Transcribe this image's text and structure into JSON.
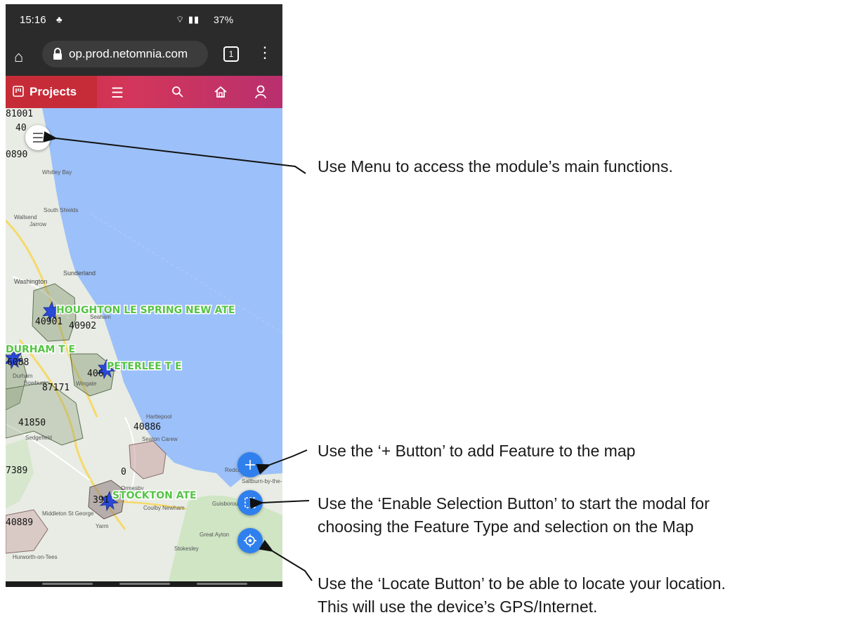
{
  "status_bar": {
    "time": "15:16",
    "signal": "37%"
  },
  "browser": {
    "url": "op.prod.netomnia.com",
    "tab_count": "1"
  },
  "app_bar": {
    "projects_label": "Projects"
  },
  "map": {
    "polygon_labels": [
      "HOUGHTON LE SPRING NEW ATE",
      "DURHAM T E",
      "PETERLEE T E",
      "STOCKTON ATE"
    ],
    "codes": [
      "81001",
      "40",
      "0890",
      "40901",
      "40902",
      "6088",
      "406",
      "87171",
      "41850",
      "40886",
      "7389",
      "0",
      "391",
      "40889"
    ],
    "place_names": [
      "Whitley Bay",
      "South Shields",
      "Wallsend",
      "Jarrow",
      "Sunderland",
      "Washington",
      "Seaham",
      "Hartlepool",
      "Seaton Carew",
      "Sedgefield",
      "Redcar",
      "Saltburn-by-the-Sea",
      "Guisborough",
      "Middleton St George",
      "Yarm",
      "Coulby Newham",
      "Great Ayton",
      "Stokesley",
      "Ormesby",
      "Wingate",
      "Hurworth-on-Tees",
      "Durham",
      "Bowburn"
    ]
  },
  "annotations": {
    "menu": "Use Menu to access the module’s main functions.",
    "add": "Use the ‘+ Button’ to add Feature to the map",
    "selection_line1": "Use the ‘Enable Selection Button’ to start the modal for",
    "selection_line2": "choosing the Feature Type and selection on the Map",
    "locate_line1": "Use the ‘Locate Button’ to be able to locate your location.",
    "locate_line2": "This will use the device’s GPS/Internet."
  },
  "colors": {
    "sea": "#9cc0f9",
    "land": "#e8ece4",
    "accent_blue": "#2f80ed",
    "app_bar": "#c92b3b",
    "polygon_label": "#55c444"
  }
}
